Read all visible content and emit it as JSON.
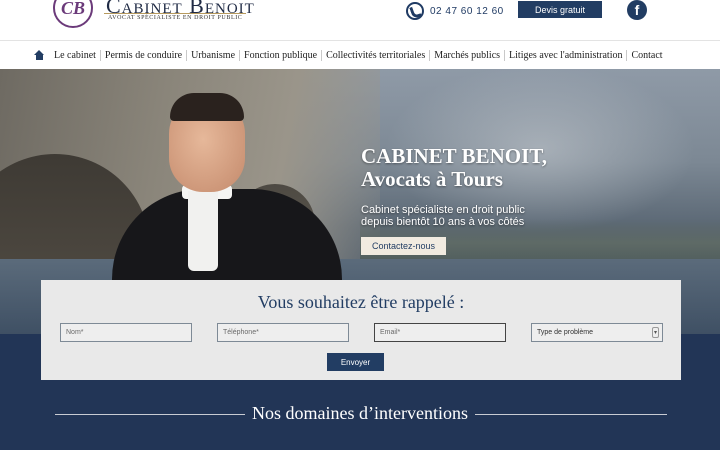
{
  "header": {
    "logo_monogram": "CB",
    "logo_name": "Cabinet Benoit",
    "logo_tagline": "AVOCAT SPÉCIALISTE EN DROIT PUBLIC",
    "phone": "02 47 60 12 60",
    "phone_icon": "phone-icon",
    "devis_button": "Devis gratuit",
    "social_icon": "facebook-icon",
    "social_glyph": "f"
  },
  "nav": {
    "home_icon": "home-icon",
    "items": [
      "Le cabinet",
      "Permis de conduire",
      "Urbanisme",
      "Fonction publique",
      "Collectivités territoriales",
      "Marchés publics",
      "Litiges avec l'administration",
      "Contact"
    ]
  },
  "hero": {
    "title_line1": "CABINET BENOIT,",
    "title_line2": "Avocats à Tours",
    "subtitle_line1": "Cabinet spécialiste en droit public",
    "subtitle_line2": "depuis bientôt 10 ans à vos côtés",
    "cta": "Contactez-nous"
  },
  "callback_form": {
    "title": "Vous souhaitez être rappelé :",
    "name_placeholder": "Nom*",
    "phone_placeholder": "Téléphone*",
    "email_placeholder": "Email*",
    "problem_select": "Type de problème",
    "submit": "Envoyer"
  },
  "domains": {
    "title": "Nos domaines d’interventions"
  },
  "colors": {
    "brand_navy": "#223d63",
    "accent_gold": "#b79a5e",
    "form_bg": "#e9e9e9"
  }
}
